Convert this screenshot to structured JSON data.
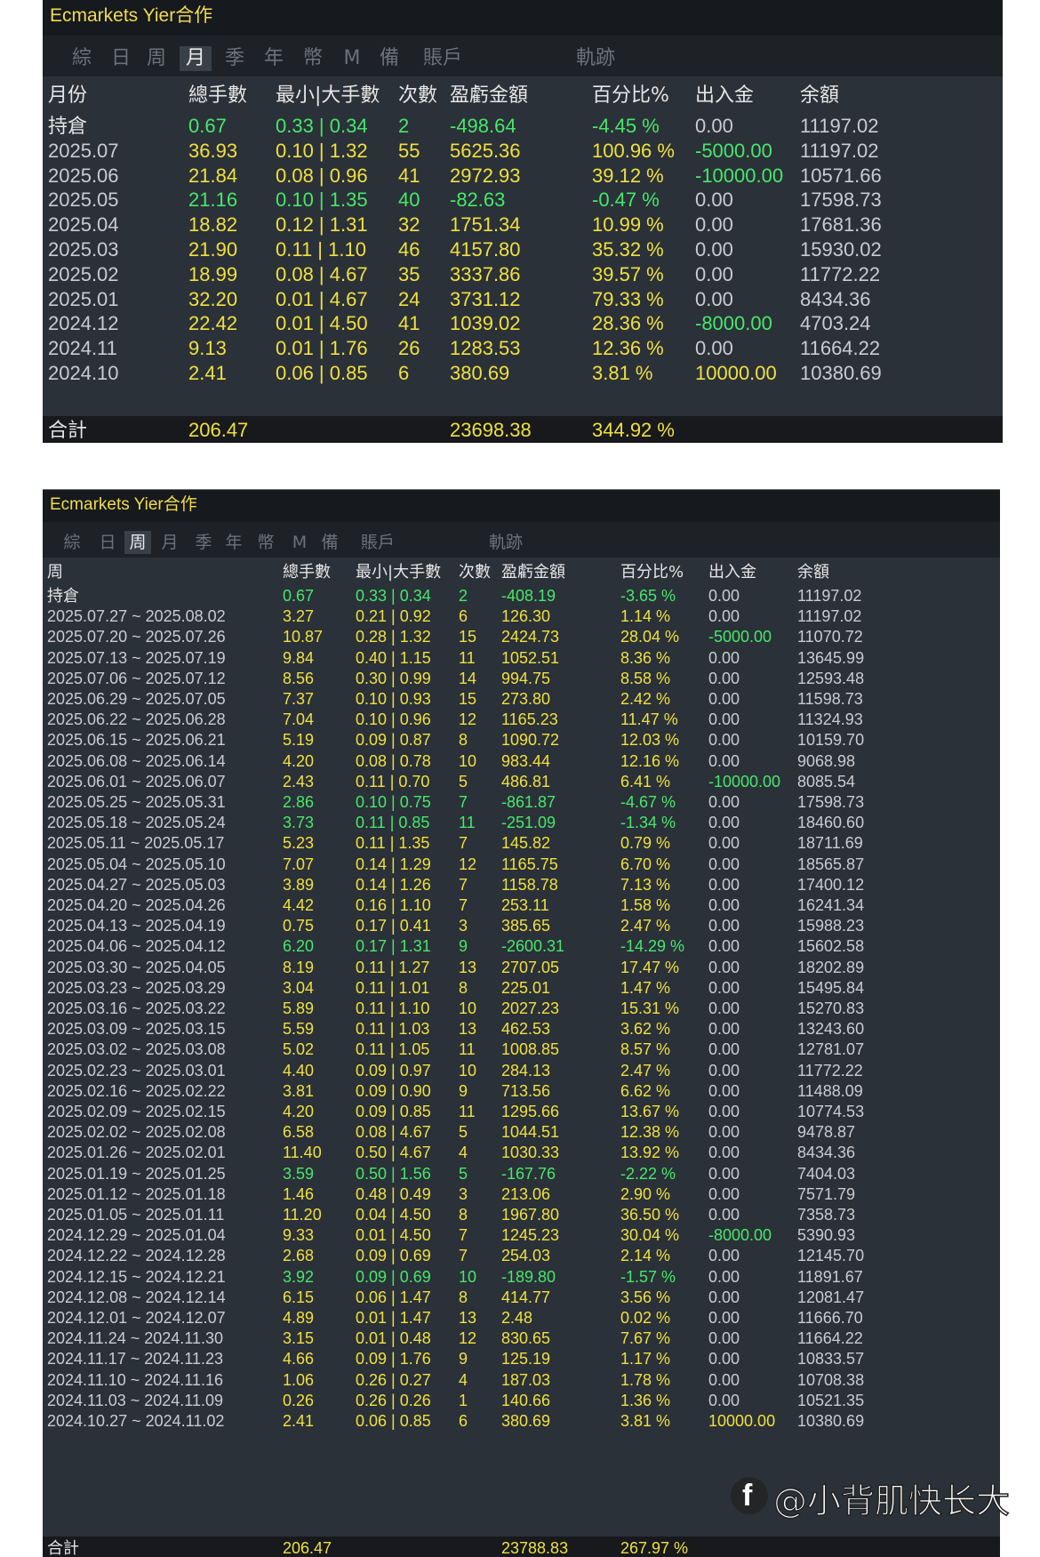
{
  "monthly": {
    "title": "Ecmarkets Yier合作",
    "tabs": [
      "綜",
      "日",
      "周",
      "月",
      "季",
      "年",
      "幣",
      "M",
      "備",
      "賬戶",
      "軌跡"
    ],
    "active_tab": "月",
    "columns": [
      "月份",
      "總手數",
      "最小|大手數",
      "次數",
      "盈虧金額",
      "百分比%",
      "出入金",
      "余額"
    ],
    "rows": [
      [
        "持倉",
        "0.67",
        "0.33 | 0.34",
        "2",
        "-498.64",
        "-4.45 %",
        "0.00",
        "11197.02"
      ],
      [
        "2025.07",
        "36.93",
        "0.10 | 1.32",
        "55",
        "5625.36",
        "100.96 %",
        "-5000.00",
        "11197.02"
      ],
      [
        "2025.06",
        "21.84",
        "0.08 | 0.96",
        "41",
        "2972.93",
        "39.12 %",
        "-10000.00",
        "10571.66"
      ],
      [
        "2025.05",
        "21.16",
        "0.10 | 1.35",
        "40",
        "-82.63",
        "-0.47 %",
        "0.00",
        "17598.73"
      ],
      [
        "2025.04",
        "18.82",
        "0.12 | 1.31",
        "32",
        "1751.34",
        "10.99 %",
        "0.00",
        "17681.36"
      ],
      [
        "2025.03",
        "21.90",
        "0.11 | 1.10",
        "46",
        "4157.80",
        "35.32 %",
        "0.00",
        "15930.02"
      ],
      [
        "2025.02",
        "18.99",
        "0.08 | 4.67",
        "35",
        "3337.86",
        "39.57 %",
        "0.00",
        "11772.22"
      ],
      [
        "2025.01",
        "32.20",
        "0.01 | 4.67",
        "24",
        "3731.12",
        "79.33 %",
        "0.00",
        "8434.36"
      ],
      [
        "2024.12",
        "22.42",
        "0.01 | 4.50",
        "41",
        "1039.02",
        "28.36 %",
        "-8000.00",
        "4703.24"
      ],
      [
        "2024.11",
        "9.13",
        "0.01 | 1.76",
        "26",
        "1283.53",
        "12.36 %",
        "0.00",
        "11664.22"
      ],
      [
        "2024.10",
        "2.41",
        "0.06 | 0.85",
        "6",
        "380.69",
        "3.81 %",
        "10000.00",
        "10380.69"
      ]
    ],
    "total": [
      "合計",
      "206.47",
      "",
      "",
      "23698.38",
      "344.92 %",
      "",
      ""
    ]
  },
  "weekly": {
    "title": "Ecmarkets Yier合作",
    "tabs": [
      "綜",
      "日",
      "周",
      "月",
      "季",
      "年",
      "幣",
      "M",
      "備",
      "賬戶",
      "軌跡"
    ],
    "active_tab": "周",
    "columns": [
      "周",
      "總手數",
      "最小|大手數",
      "次數",
      "盈虧金額",
      "百分比%",
      "出入金",
      "余額"
    ],
    "rows": [
      [
        "持倉",
        "0.67",
        "0.33 | 0.34",
        "2",
        "-408.19",
        "-3.65 %",
        "0.00",
        "11197.02"
      ],
      [
        "2025.07.27 ~ 2025.08.02",
        "3.27",
        "0.21 | 0.92",
        "6",
        "126.30",
        "1.14 %",
        "0.00",
        "11197.02"
      ],
      [
        "2025.07.20 ~ 2025.07.26",
        "10.87",
        "0.28 | 1.32",
        "15",
        "2424.73",
        "28.04 %",
        "-5000.00",
        "11070.72"
      ],
      [
        "2025.07.13 ~ 2025.07.19",
        "9.84",
        "0.40 | 1.15",
        "11",
        "1052.51",
        "8.36 %",
        "0.00",
        "13645.99"
      ],
      [
        "2025.07.06 ~ 2025.07.12",
        "8.56",
        "0.30 | 0.99",
        "14",
        "994.75",
        "8.58 %",
        "0.00",
        "12593.48"
      ],
      [
        "2025.06.29 ~ 2025.07.05",
        "7.37",
        "0.10 | 0.93",
        "15",
        "273.80",
        "2.42 %",
        "0.00",
        "11598.73"
      ],
      [
        "2025.06.22 ~ 2025.06.28",
        "7.04",
        "0.10 | 0.96",
        "12",
        "1165.23",
        "11.47 %",
        "0.00",
        "11324.93"
      ],
      [
        "2025.06.15 ~ 2025.06.21",
        "5.19",
        "0.09 | 0.87",
        "8",
        "1090.72",
        "12.03 %",
        "0.00",
        "10159.70"
      ],
      [
        "2025.06.08 ~ 2025.06.14",
        "4.20",
        "0.08 | 0.78",
        "10",
        "983.44",
        "12.16 %",
        "0.00",
        "9068.98"
      ],
      [
        "2025.06.01 ~ 2025.06.07",
        "2.43",
        "0.11 | 0.70",
        "5",
        "486.81",
        "6.41 %",
        "-10000.00",
        "8085.54"
      ],
      [
        "2025.05.25 ~ 2025.05.31",
        "2.86",
        "0.10 | 0.75",
        "7",
        "-861.87",
        "-4.67 %",
        "0.00",
        "17598.73"
      ],
      [
        "2025.05.18 ~ 2025.05.24",
        "3.73",
        "0.11 | 0.85",
        "11",
        "-251.09",
        "-1.34 %",
        "0.00",
        "18460.60"
      ],
      [
        "2025.05.11 ~ 2025.05.17",
        "5.23",
        "0.11 | 1.35",
        "7",
        "145.82",
        "0.79 %",
        "0.00",
        "18711.69"
      ],
      [
        "2025.05.04 ~ 2025.05.10",
        "7.07",
        "0.14 | 1.29",
        "12",
        "1165.75",
        "6.70 %",
        "0.00",
        "18565.87"
      ],
      [
        "2025.04.27 ~ 2025.05.03",
        "3.89",
        "0.14 | 1.26",
        "7",
        "1158.78",
        "7.13 %",
        "0.00",
        "17400.12"
      ],
      [
        "2025.04.20 ~ 2025.04.26",
        "4.42",
        "0.16 | 1.10",
        "7",
        "253.11",
        "1.58 %",
        "0.00",
        "16241.34"
      ],
      [
        "2025.04.13 ~ 2025.04.19",
        "0.75",
        "0.17 | 0.41",
        "3",
        "385.65",
        "2.47 %",
        "0.00",
        "15988.23"
      ],
      [
        "2025.04.06 ~ 2025.04.12",
        "6.20",
        "0.17 | 1.31",
        "9",
        "-2600.31",
        "-14.29 %",
        "0.00",
        "15602.58"
      ],
      [
        "2025.03.30 ~ 2025.04.05",
        "8.19",
        "0.11 | 1.27",
        "13",
        "2707.05",
        "17.47 %",
        "0.00",
        "18202.89"
      ],
      [
        "2025.03.23 ~ 2025.03.29",
        "3.04",
        "0.11 | 1.01",
        "8",
        "225.01",
        "1.47 %",
        "0.00",
        "15495.84"
      ],
      [
        "2025.03.16 ~ 2025.03.22",
        "5.89",
        "0.11 | 1.10",
        "10",
        "2027.23",
        "15.31 %",
        "0.00",
        "15270.83"
      ],
      [
        "2025.03.09 ~ 2025.03.15",
        "5.59",
        "0.11 | 1.03",
        "13",
        "462.53",
        "3.62 %",
        "0.00",
        "13243.60"
      ],
      [
        "2025.03.02 ~ 2025.03.08",
        "5.02",
        "0.11 | 1.05",
        "11",
        "1008.85",
        "8.57 %",
        "0.00",
        "12781.07"
      ],
      [
        "2025.02.23 ~ 2025.03.01",
        "4.40",
        "0.09 | 0.97",
        "10",
        "284.13",
        "2.47 %",
        "0.00",
        "11772.22"
      ],
      [
        "2025.02.16 ~ 2025.02.22",
        "3.81",
        "0.09 | 0.90",
        "9",
        "713.56",
        "6.62 %",
        "0.00",
        "11488.09"
      ],
      [
        "2025.02.09 ~ 2025.02.15",
        "4.20",
        "0.09 | 0.85",
        "11",
        "1295.66",
        "13.67 %",
        "0.00",
        "10774.53"
      ],
      [
        "2025.02.02 ~ 2025.02.08",
        "6.58",
        "0.08 | 4.67",
        "5",
        "1044.51",
        "12.38 %",
        "0.00",
        "9478.87"
      ],
      [
        "2025.01.26 ~ 2025.02.01",
        "11.40",
        "0.50 | 4.67",
        "4",
        "1030.33",
        "13.92 %",
        "0.00",
        "8434.36"
      ],
      [
        "2025.01.19 ~ 2025.01.25",
        "3.59",
        "0.50 | 1.56",
        "5",
        "-167.76",
        "-2.22 %",
        "0.00",
        "7404.03"
      ],
      [
        "2025.01.12 ~ 2025.01.18",
        "1.46",
        "0.48 | 0.49",
        "3",
        "213.06",
        "2.90 %",
        "0.00",
        "7571.79"
      ],
      [
        "2025.01.05 ~ 2025.01.11",
        "11.20",
        "0.04 | 4.50",
        "8",
        "1967.80",
        "36.50 %",
        "0.00",
        "7358.73"
      ],
      [
        "2024.12.29 ~ 2025.01.04",
        "9.33",
        "0.01 | 4.50",
        "7",
        "1245.23",
        "30.04 %",
        "-8000.00",
        "5390.93"
      ],
      [
        "2024.12.22 ~ 2024.12.28",
        "2.68",
        "0.09 | 0.69",
        "7",
        "254.03",
        "2.14 %",
        "0.00",
        "12145.70"
      ],
      [
        "2024.12.15 ~ 2024.12.21",
        "3.92",
        "0.09 | 0.69",
        "10",
        "-189.80",
        "-1.57 %",
        "0.00",
        "11891.67"
      ],
      [
        "2024.12.08 ~ 2024.12.14",
        "6.15",
        "0.06 | 1.47",
        "8",
        "414.77",
        "3.56 %",
        "0.00",
        "12081.47"
      ],
      [
        "2024.12.01 ~ 2024.12.07",
        "4.89",
        "0.01 | 1.47",
        "13",
        "2.48",
        "0.02 %",
        "0.00",
        "11666.70"
      ],
      [
        "2024.11.24 ~ 2024.11.30",
        "3.15",
        "0.01 | 0.48",
        "12",
        "830.65",
        "7.67 %",
        "0.00",
        "11664.22"
      ],
      [
        "2024.11.17 ~ 2024.11.23",
        "4.66",
        "0.09 | 1.76",
        "9",
        "125.19",
        "1.17 %",
        "0.00",
        "10833.57"
      ],
      [
        "2024.11.10 ~ 2024.11.16",
        "1.06",
        "0.26 | 0.27",
        "4",
        "187.03",
        "1.78 %",
        "0.00",
        "10708.38"
      ],
      [
        "2024.11.03 ~ 2024.11.09",
        "0.26",
        "0.26 | 0.26",
        "1",
        "140.66",
        "1.36 %",
        "0.00",
        "10521.35"
      ],
      [
        "2024.10.27 ~ 2024.11.02",
        "2.41",
        "0.06 | 0.85",
        "6",
        "380.69",
        "3.81 %",
        "10000.00",
        "10380.69"
      ]
    ],
    "total": [
      "合計",
      "206.47",
      "",
      "",
      "23788.83",
      "267.97 %",
      "",
      ""
    ]
  },
  "watermark": {
    "logo": "f",
    "text": "@小背肌快长大"
  },
  "colors": {
    "positive": "#f0e040",
    "negative": "#46e86a",
    "neutral": "#c9ccd0",
    "label": "#e6e6e6",
    "title": "#f1dc4e",
    "panel_bg": "#2b3138"
  }
}
